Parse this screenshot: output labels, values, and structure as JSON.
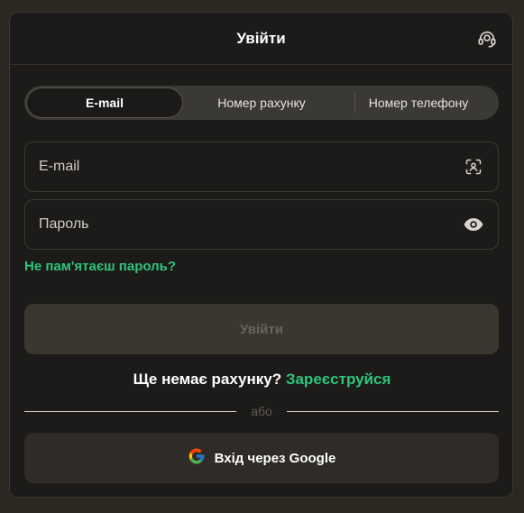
{
  "header": {
    "title": "Увійти",
    "support_icon": "headset-icon"
  },
  "tabs": [
    {
      "label": "E-mail",
      "active": true
    },
    {
      "label": "Номер рахунку",
      "active": false
    },
    {
      "label": "Номер телефону",
      "active": false
    }
  ],
  "email_field": {
    "placeholder": "E-mail",
    "value": "",
    "icon": "face-scan-icon"
  },
  "password_field": {
    "placeholder": "Пароль",
    "value": "",
    "icon": "eye-icon"
  },
  "forgot_link": "Не пам'ятаєш пароль?",
  "submit_label": "Увійти",
  "register": {
    "prompt": "Ще немає рахунку?",
    "link": "Зареєструйся"
  },
  "divider_text": "або",
  "google": {
    "label": "Вхід через Google",
    "icon": "google-icon"
  },
  "colors": {
    "accent": "#2ec47a",
    "background": "#1c1b19",
    "submit_disabled": "#3a372f"
  }
}
